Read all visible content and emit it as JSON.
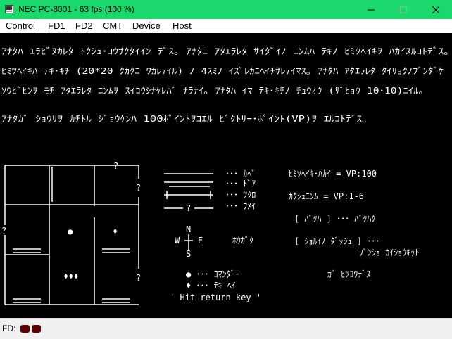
{
  "window": {
    "title": "NEC PC-8001 - 63 fps (100 %)",
    "titlebar_color": "#1ad86b"
  },
  "menu": {
    "items": [
      "Control",
      "FD1",
      "FD2",
      "CMT",
      "Device",
      "Host"
    ]
  },
  "screen": {
    "intro": [
      "ｱﾅﾀﾊ ｴﾗﾋﾞﾇｶﾚﾀ ﾄｸｼｭ･ｺｳｻｸﾀｲｲﾝ ﾃﾞｽ｡ ｱﾅﾀﾆ ｱﾀｴﾗﾚﾀ ｻｲﾀﾞｲﾉ ﾆﾝﾑﾊ ﾃｷﾉ ﾋﾐﾂﾍｲｷｦ ﾊｶｲｽﾙｺﾄﾃﾞｽ｡",
      "ﾋﾐﾂﾍｲｷﾊ ﾃｷ･ｷﾁ (20*20 ｸｶｸﾆ ﾜｶﾚﾃｲﾙ) ﾉ 4ｽﾐﾉ ｲｽﾞﾚｶﾆﾍｲﾁｻﾚﾃｲﾏｽ｡ ｱﾅﾀﾊ ｱﾀｴﾗﾚﾀ ﾀｲﾘｮｸﾉﾌﾞﾝﾀﾞｹ",
      "ｿｳﾋﾞﾋﾝｦ ﾓﾁ ｱﾀｴﾗﾚﾀ ﾆﾝﾑｦ ｽｲｺｳｼﾅｹﾚﾊﾞ ﾅﾗﾅｲ｡ ｱﾅﾀﾊ ｲﾏ ﾃｷ･ｷﾁﾉ ﾁｭｳｵｳ (ｻﾞﾋｮｳ 10･10)ﾆｲﾙ｡",
      "  ｱﾅﾀｶﾞ ｼｮｳﾘｦ ｶﾁﾄﾙ ｼﾞｮｳｹﾝﾊ 100ﾎﾟｲﾝﾄｦｺｴﾙ ﾋﾞｸﾄﾘｰ･ﾎﾟｲﾝﾄ(VP)ｦ ｴﾙｺﾄﾃﾞｽ｡"
    ],
    "map_marks": [
      "?",
      "?",
      "?",
      "?"
    ],
    "player_mark": "●",
    "enemy_mark": "♦",
    "items_mark": "♦♦♦",
    "legend": {
      "wall": "･･･ ｶﾍﾞ",
      "door": "･･･ ﾄﾞｱ",
      "trap": "･･･ ﾂｸﾛ",
      "unknown": "･･･ ﾌﾒｲ",
      "unknown_mark": "?"
    },
    "compass": {
      "n": "N",
      "w": "W",
      "e": "E",
      "s": "S",
      "label": "ﾎｳｶﾞｸ"
    },
    "players": {
      "commander": "● ･･･ ｺﾏﾝﾀﾞｰ",
      "enemy": "♦ ･･･ ﾃｷ ﾍｲ"
    },
    "rules": {
      "vp_destroy": "ﾋﾐﾂﾍｲｷ･ﾊｶｲ = VP:100",
      "vp_kill": "ｶｸｼｭﾆﾝﾑ    = VP:1-6",
      "attack": "[ ﾊﾞｸﾊ ] ･･･ ﾊﾞｸﾊｸ",
      "dash": "[ ｼｮﾙｲﾉ ﾀﾞｯｼｭ ] ･･･",
      "dash2": "ﾌﾞﾝｼｮ ｶｲｼｮｳｷｯﾄ",
      "goal": "ｶﾞ ﾋﾂﾖｳﾃﾞｽ"
    },
    "prompt": "' Hit return key '"
  },
  "status": {
    "fd_label": "FD:",
    "led_color": "#5a0000"
  }
}
